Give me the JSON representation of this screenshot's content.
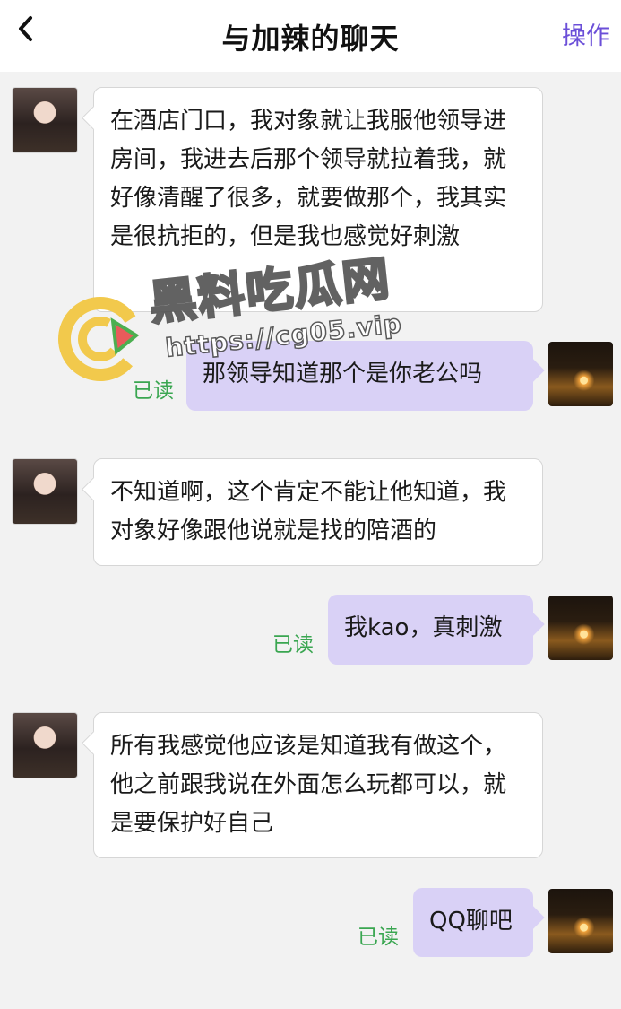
{
  "header": {
    "title": "与加辣的聊天",
    "ops_label": "操作"
  },
  "messages": [
    {
      "side": "in",
      "text": "在酒店门口，我对象就让我服他领导进房间，我进去后那个领导就拉着我，就好像清醒了很多，就要做那个，我其实是很抗拒的，但是我也感觉好刺激"
    },
    {
      "side": "out",
      "text": "那领导知道那个是你老公吗",
      "status": "已读"
    },
    {
      "side": "in",
      "text": "不知道啊，这个肯定不能让他知道，我对象好像跟他说就是找的陪酒的"
    },
    {
      "side": "out",
      "text": "我kao，真刺激",
      "status": "已读"
    },
    {
      "side": "in",
      "text": "所有我感觉他应该是知道我有做这个，他之前跟我说在外面怎么玩都可以，就是要保护好自己"
    },
    {
      "side": "out",
      "text": "QQ聊吧",
      "status": "已读"
    }
  ],
  "watermark": {
    "brand": "黑料吃瓜网",
    "url": "https://cg05.vip"
  },
  "colors": {
    "accent": "#6b4fd8",
    "read_status": "#3aa651",
    "outgoing_bubble": "#d9d1f6",
    "incoming_bubble": "#ffffff",
    "background": "#f2f2f2"
  }
}
